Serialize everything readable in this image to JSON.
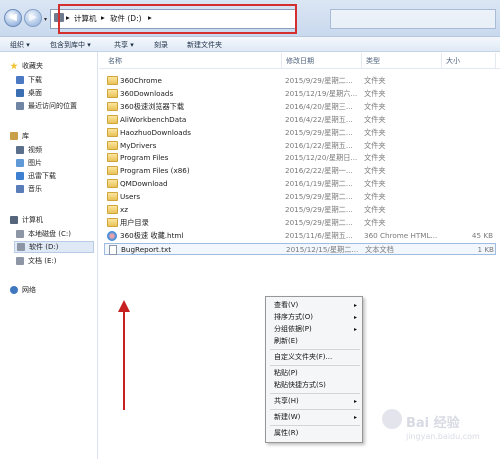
{
  "address": {
    "crumbs": [
      "▸",
      "计算机",
      "▸",
      "软件 (D:)",
      "▸"
    ]
  },
  "toolbar": {
    "organize": "组织 ▾",
    "include_in_library": "包含到库中 ▾",
    "share": "共享 ▾",
    "burn": "刻录",
    "new_folder": "新建文件夹"
  },
  "sidebar": {
    "favorites": "收藏夹",
    "downloads": "下载",
    "desktop": "桌面",
    "recent": "最近访问的位置",
    "libraries": "库",
    "videos": "视频",
    "pictures": "图片",
    "thunder": "迅雷下载",
    "music": "音乐",
    "computer": "计算机",
    "local_c": "本地磁盘 (C:)",
    "soft_d": "软件 (D:)",
    "docs_e": "文档 (E:)",
    "network": "网络"
  },
  "columns": {
    "name": "名称",
    "date": "修改日期",
    "type": "类型",
    "size": "大小"
  },
  "files": [
    {
      "name": "360Chrome",
      "date": "2015/9/29/星期二...",
      "type": "文件夹",
      "size": "",
      "icon": "folder"
    },
    {
      "name": "360Downloads",
      "date": "2015/12/19/星期六...",
      "type": "文件夹",
      "size": "",
      "icon": "folder"
    },
    {
      "name": "360极速浏览器下载",
      "date": "2016/4/20/星期三...",
      "type": "文件夹",
      "size": "",
      "icon": "folder"
    },
    {
      "name": "AliWorkbenchData",
      "date": "2016/4/22/星期五...",
      "type": "文件夹",
      "size": "",
      "icon": "folder"
    },
    {
      "name": "HaozhuoDownloads",
      "date": "2015/9/29/星期二...",
      "type": "文件夹",
      "size": "",
      "icon": "folder"
    },
    {
      "name": "MyDrivers",
      "date": "2016/1/22/星期五...",
      "type": "文件夹",
      "size": "",
      "icon": "folder"
    },
    {
      "name": "Program Files",
      "date": "2015/12/20/星期日...",
      "type": "文件夹",
      "size": "",
      "icon": "folder"
    },
    {
      "name": "Program Files (x86)",
      "date": "2016/2/22/星期一...",
      "type": "文件夹",
      "size": "",
      "icon": "folder"
    },
    {
      "name": "QMDownload",
      "date": "2016/1/19/星期二...",
      "type": "文件夹",
      "size": "",
      "icon": "folder"
    },
    {
      "name": "Users",
      "date": "2015/9/29/星期二...",
      "type": "文件夹",
      "size": "",
      "icon": "folder"
    },
    {
      "name": "xz",
      "date": "2015/9/29/星期二...",
      "type": "文件夹",
      "size": "",
      "icon": "folder"
    },
    {
      "name": "用户目录",
      "date": "2015/9/29/星期二...",
      "type": "文件夹",
      "size": "",
      "icon": "folder"
    },
    {
      "name": "360极速 收藏.html",
      "date": "2015/11/6/星期五...",
      "type": "360 Chrome HTML...",
      "size": "45 KB",
      "icon": "html"
    },
    {
      "name": "BugReport.txt",
      "date": "2015/12/15/星期二...",
      "type": "文本文档",
      "size": "1 KB",
      "icon": "txt"
    }
  ],
  "context_menu": {
    "view": "查看(V)",
    "sort_by": "排序方式(O)",
    "group_by": "分组依据(P)",
    "refresh": "刷新(E)",
    "customize": "自定义文件夹(F)...",
    "paste": "粘贴(P)",
    "paste_shortcut": "粘贴快捷方式(S)",
    "share_with": "共享(H)",
    "new": "新建(W)",
    "properties": "属性(R)"
  },
  "watermark": {
    "brand": "Bai 经验",
    "url": "jingyan.baidu.com"
  },
  "colors": {
    "highlight_red": "#d32f2f",
    "arrow_red": "#c72020",
    "folder_yellow": "#e9c358"
  }
}
